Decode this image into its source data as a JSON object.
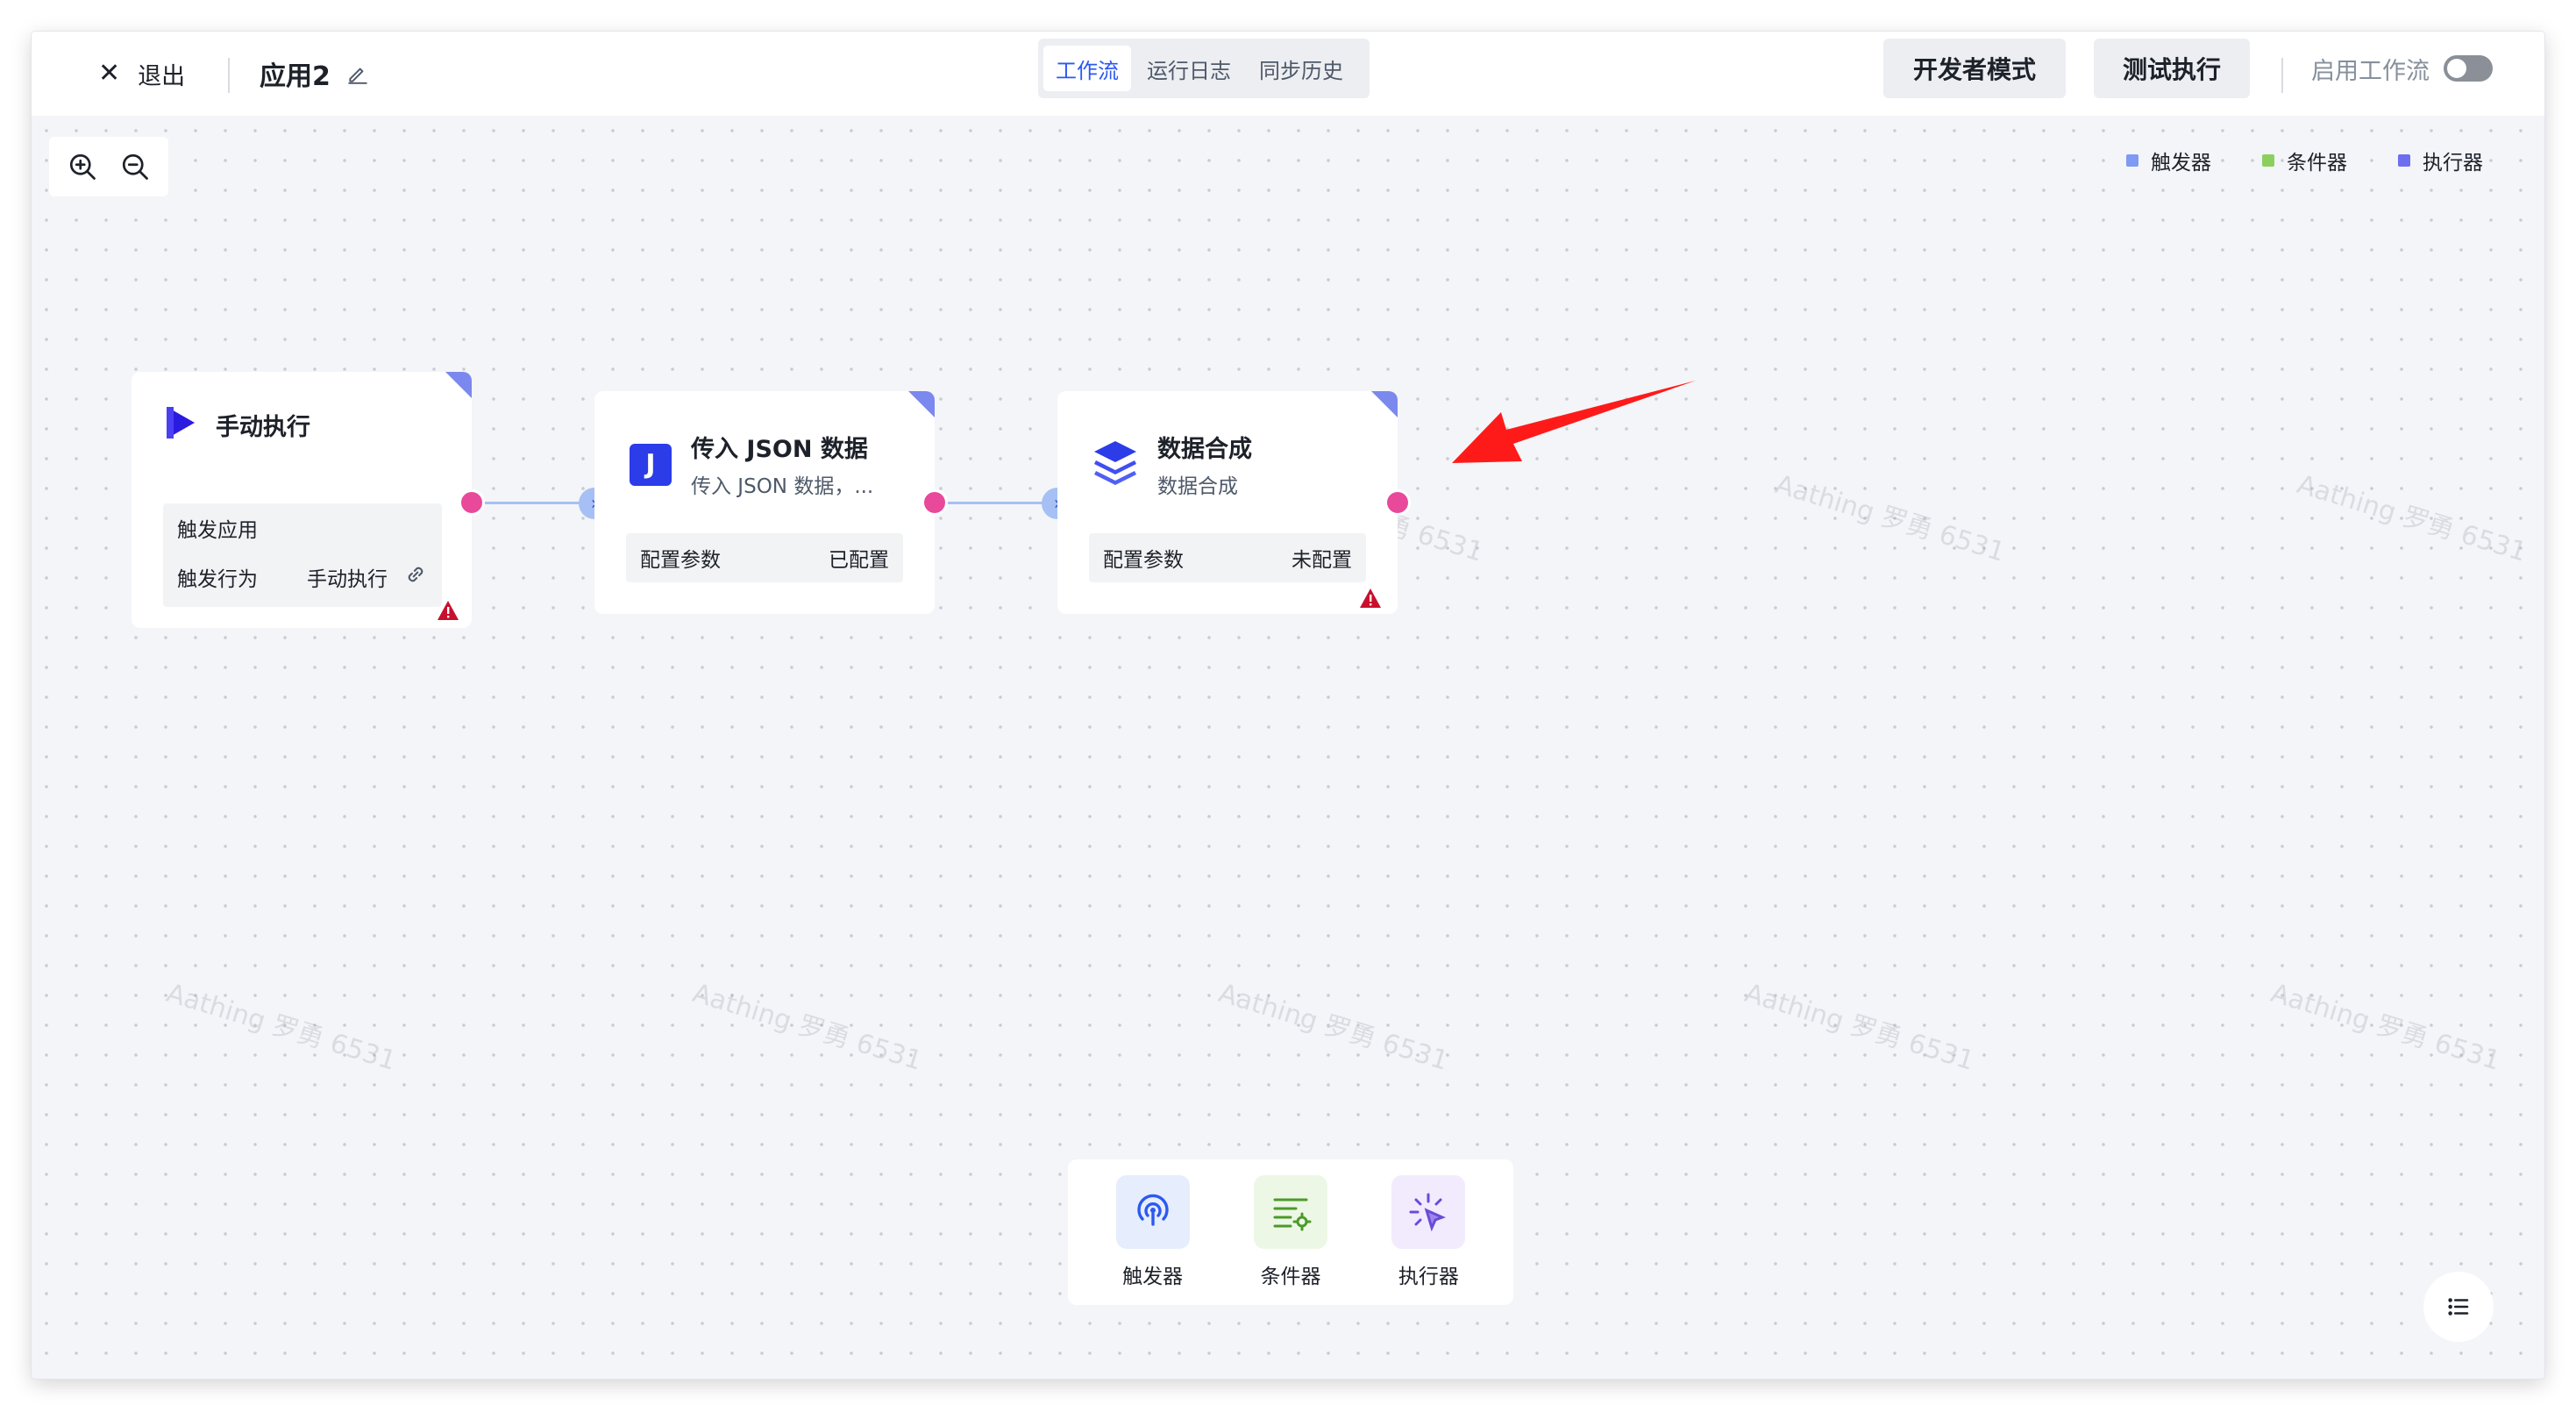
{
  "header": {
    "exit_label": "退出",
    "app_name": "应用2",
    "tabs": [
      {
        "label": "工作流",
        "active": true
      },
      {
        "label": "运行日志",
        "active": false
      },
      {
        "label": "同步历史",
        "active": false
      }
    ],
    "developer_mode_label": "开发者模式",
    "test_run_label": "测试执行",
    "enable_workflow_label": "启用工作流",
    "enable_workflow_on": false
  },
  "legend": [
    {
      "label": "触发器",
      "color": "#7f9af2"
    },
    {
      "label": "条件器",
      "color": "#8ccf5e"
    },
    {
      "label": "执行器",
      "color": "#6e6ef0"
    }
  ],
  "nodes": {
    "trigger": {
      "title": "手动执行",
      "rows": [
        {
          "label": "触发应用",
          "value": ""
        },
        {
          "label": "触发行为",
          "value": "手动执行"
        }
      ]
    },
    "json": {
      "title": "传入 JSON 数据",
      "subtitle": "传入 JSON 数据，...",
      "icon_letter": "J",
      "config_label": "配置参数",
      "config_status": "已配置"
    },
    "compose": {
      "title": "数据合成",
      "subtitle": "数据合成",
      "config_label": "配置参数",
      "config_status": "未配置"
    }
  },
  "palette": [
    {
      "label": "触发器",
      "icon": "trigger-icon"
    },
    {
      "label": "条件器",
      "icon": "condition-icon"
    },
    {
      "label": "执行器",
      "icon": "executor-icon"
    }
  ],
  "watermark": "Aathing 罗勇 6531",
  "colors": {
    "accent": "#2b59f2",
    "port": "#e8499a",
    "edge": "#a6c0f5",
    "warning": "#c8102e",
    "annotation_arrow": "#ff1a1a"
  }
}
